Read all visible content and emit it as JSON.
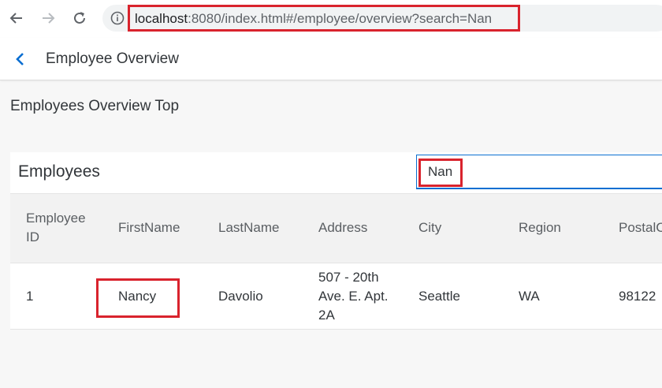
{
  "browser": {
    "url_host": "localhost",
    "url_rest": ":8080/index.html#/employee/overview?search=Nan",
    "icons": {
      "back": "arrow-left-icon",
      "forward": "arrow-right-icon",
      "reload": "reload-icon",
      "info": "info-circle-icon"
    }
  },
  "header": {
    "title": "Employee Overview",
    "back_icon": "chevron-left-icon"
  },
  "page": {
    "section_title": "Employees Overview Top"
  },
  "employees": {
    "title": "Employees",
    "search": {
      "value": "Nan"
    },
    "columns": {
      "employee_id_line1": "Employee",
      "employee_id_line2": "ID",
      "first_name": "FirstName",
      "last_name": "LastName",
      "address": "Address",
      "city": "City",
      "region": "Region",
      "postal_code": "PostalC"
    },
    "rows": [
      {
        "employee_id": "1",
        "first_name": "Nancy",
        "last_name": "Davolio",
        "address_line1": "507 - 20th",
        "address_line2": "Ave. E. Apt.",
        "address_line3": "2A",
        "city": "Seattle",
        "region": "WA",
        "postal_code": "98122"
      }
    ]
  },
  "colors": {
    "accent": "#0a6ed1",
    "highlight": "#d9232d",
    "text": "#32363a"
  }
}
